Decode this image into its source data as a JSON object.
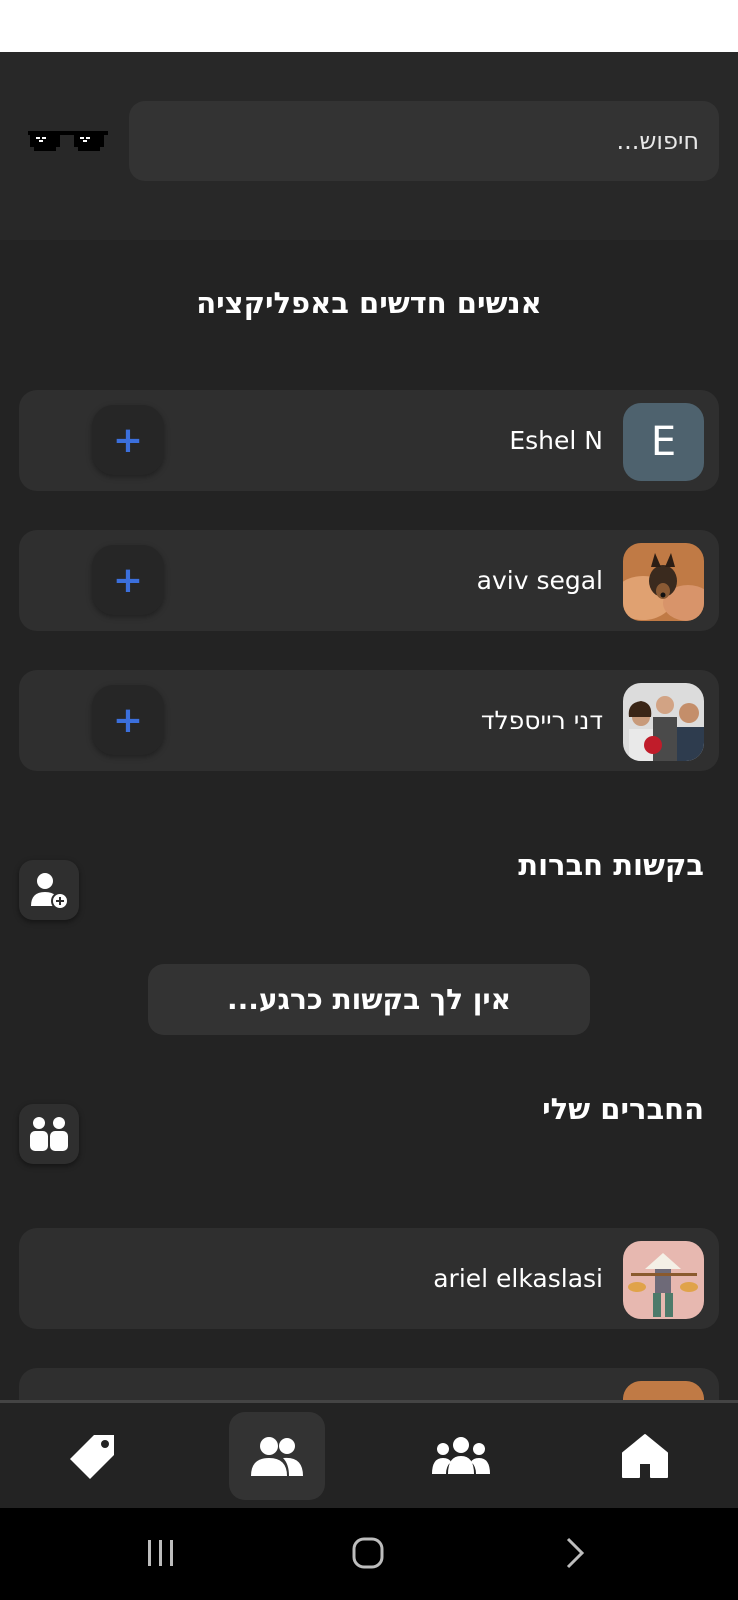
{
  "search": {
    "placeholder": "חיפוש..."
  },
  "new_people": {
    "title": "אנשים חדשים באפליקציה",
    "add_label": "+",
    "people": [
      {
        "name": "Eshel N",
        "avatar_letter": "E",
        "avatar_color": "#4e626e"
      },
      {
        "name": "aviv segal"
      },
      {
        "name": "דני רייספלד"
      }
    ]
  },
  "friend_requests": {
    "title": "בקשות חברות",
    "empty_text": "אין לך בקשות כרגע..."
  },
  "my_friends": {
    "title": "החברים שלי",
    "friends": [
      {
        "name": "ariel elkaslasi"
      },
      {
        "name": ""
      }
    ]
  },
  "bottom_nav": {
    "items": [
      {
        "icon": "tag-icon"
      },
      {
        "icon": "friends-icon",
        "active": true
      },
      {
        "icon": "groups-icon"
      },
      {
        "icon": "home-icon"
      }
    ]
  },
  "colors": {
    "background": "#232323",
    "card": "#2f2f2f",
    "accent_plus": "#3b6fdc"
  }
}
